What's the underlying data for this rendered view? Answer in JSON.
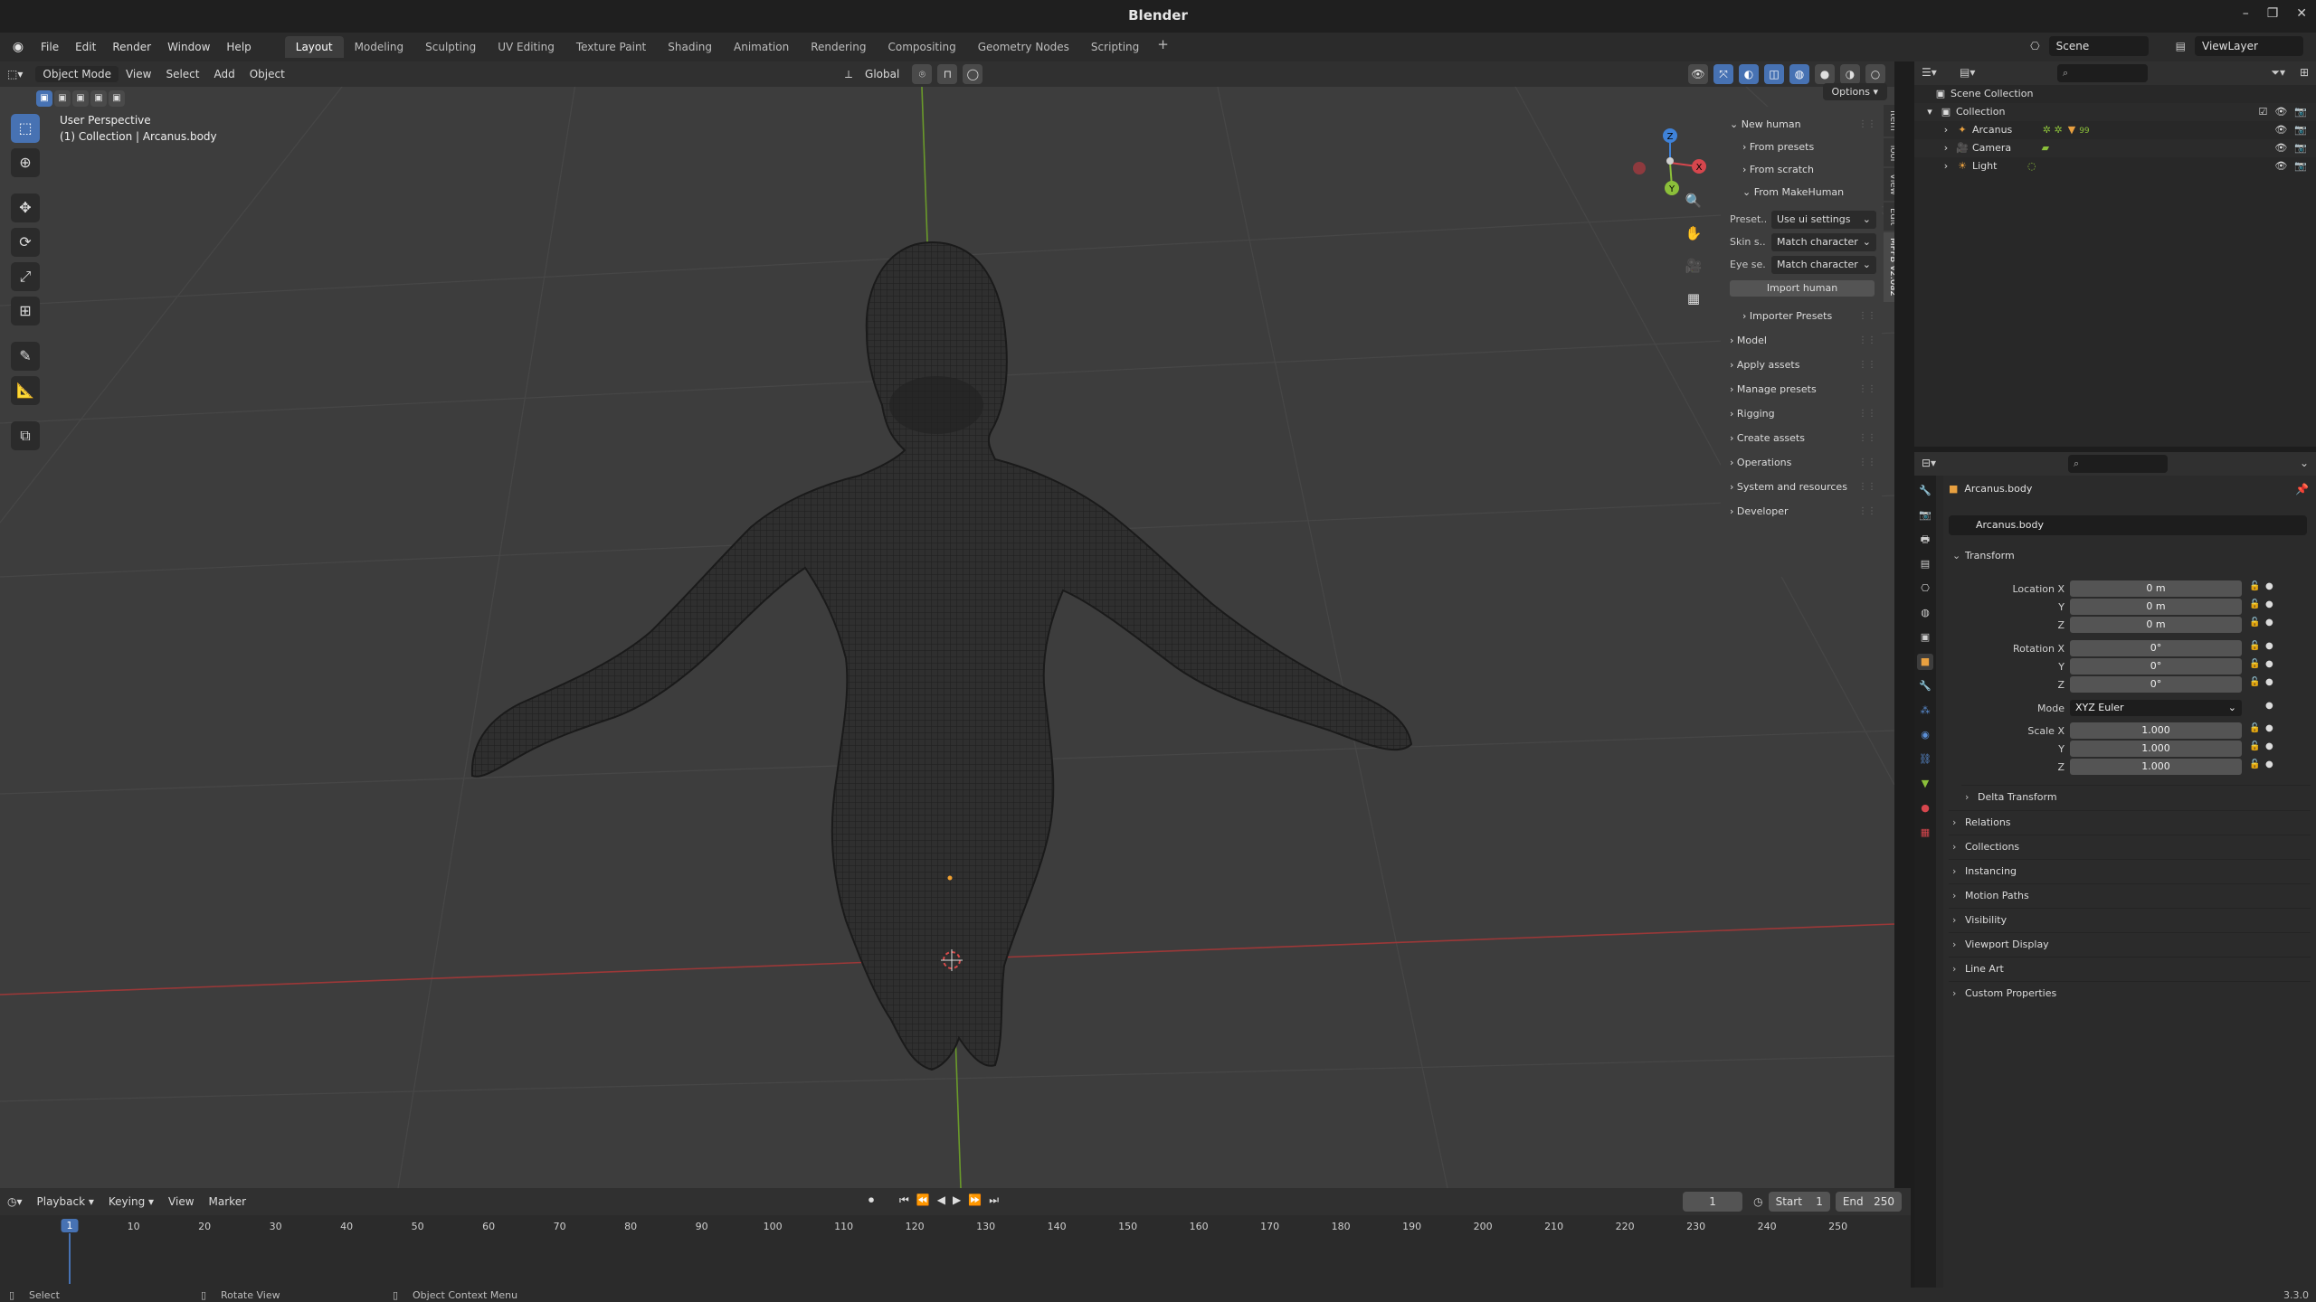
{
  "window": {
    "title": "Blender",
    "controls": [
      "–",
      "❐",
      "✕"
    ]
  },
  "menubar": {
    "menus": [
      "File",
      "Edit",
      "Render",
      "Window",
      "Help"
    ],
    "workspaces": [
      "Layout",
      "Modeling",
      "Sculpting",
      "UV Editing",
      "Texture Paint",
      "Shading",
      "Animation",
      "Rendering",
      "Compositing",
      "Geometry Nodes",
      "Scripting"
    ],
    "active_workspace": "Layout",
    "add_tab": "+",
    "scene": "Scene",
    "view_layer": "ViewLayer"
  },
  "viewport": {
    "mode": "Object Mode",
    "menus": [
      "View",
      "Select",
      "Add",
      "Object"
    ],
    "transform_orientation": "Global",
    "options_label": "Options",
    "perspective_label": "User Perspective",
    "collection_label": "(1) Collection | Arcanus.body",
    "axes": {
      "x": "X",
      "y": "Y",
      "z": "Z"
    }
  },
  "sidebar": {
    "tabs": [
      "Item",
      "Tool",
      "View",
      "Edit",
      "MPFB v2.0a2"
    ],
    "active_tab": "MPFB v2.0a2",
    "new_human": "New human",
    "from_presets": "From presets",
    "from_scratch": "From scratch",
    "from_makehuman": "From MakeHuman",
    "props": [
      {
        "label": "Preset...",
        "value": "Use ui settings"
      },
      {
        "label": "Skin s...",
        "value": "Match character na..."
      },
      {
        "label": "Eye se...",
        "value": "Match character na..."
      }
    ],
    "import_button": "Import human",
    "importer_presets": "Importer Presets",
    "sections": [
      "Model",
      "Apply assets",
      "Manage presets",
      "Rigging",
      "Create assets",
      "Operations",
      "System and resources",
      "Developer"
    ]
  },
  "timeline": {
    "menus": [
      "Playback",
      "Keying",
      "View",
      "Marker"
    ],
    "current_frame": "1",
    "start_label": "Start",
    "start": "1",
    "end_label": "End",
    "end": "250",
    "ticks": [
      "1",
      "10",
      "20",
      "30",
      "40",
      "50",
      "60",
      "70",
      "80",
      "90",
      "100",
      "110",
      "120",
      "130",
      "140",
      "150",
      "160",
      "170",
      "180",
      "190",
      "200",
      "210",
      "220",
      "230",
      "240",
      "250"
    ]
  },
  "statusbar": {
    "select": "Select",
    "rotate": "Rotate View",
    "context": "Object Context Menu",
    "version": "3.3.0"
  },
  "outliner": {
    "scene_collection": "Scene Collection",
    "collection": "Collection",
    "objects": [
      "Arcanus",
      "Camera",
      "Light"
    ],
    "arcanus_badge": "99"
  },
  "properties": {
    "object_name": "Arcanus.body",
    "name_field": "Arcanus.body",
    "transform_label": "Transform",
    "location_label": "Location X",
    "location": [
      "0 m",
      "0 m",
      "0 m"
    ],
    "rotation_label": "Rotation X",
    "rotation": [
      "0°",
      "0°",
      "0°"
    ],
    "y_label": "Y",
    "z_label": "Z",
    "mode_label": "Mode",
    "mode": "XYZ Euler",
    "scale_label": "Scale X",
    "scale": [
      "1.000",
      "1.000",
      "1.000"
    ],
    "delta_transform": "Delta Transform",
    "sections": [
      "Relations",
      "Collections",
      "Instancing",
      "Motion Paths",
      "Visibility",
      "Viewport Display",
      "Line Art",
      "Custom Properties"
    ]
  },
  "colors": {
    "accent": "#4772b3",
    "x_axis": "#d6464d",
    "y_axis": "#8bbf3a",
    "z_axis": "#3f82d8",
    "viewport_bg": "#3d3d3d"
  }
}
